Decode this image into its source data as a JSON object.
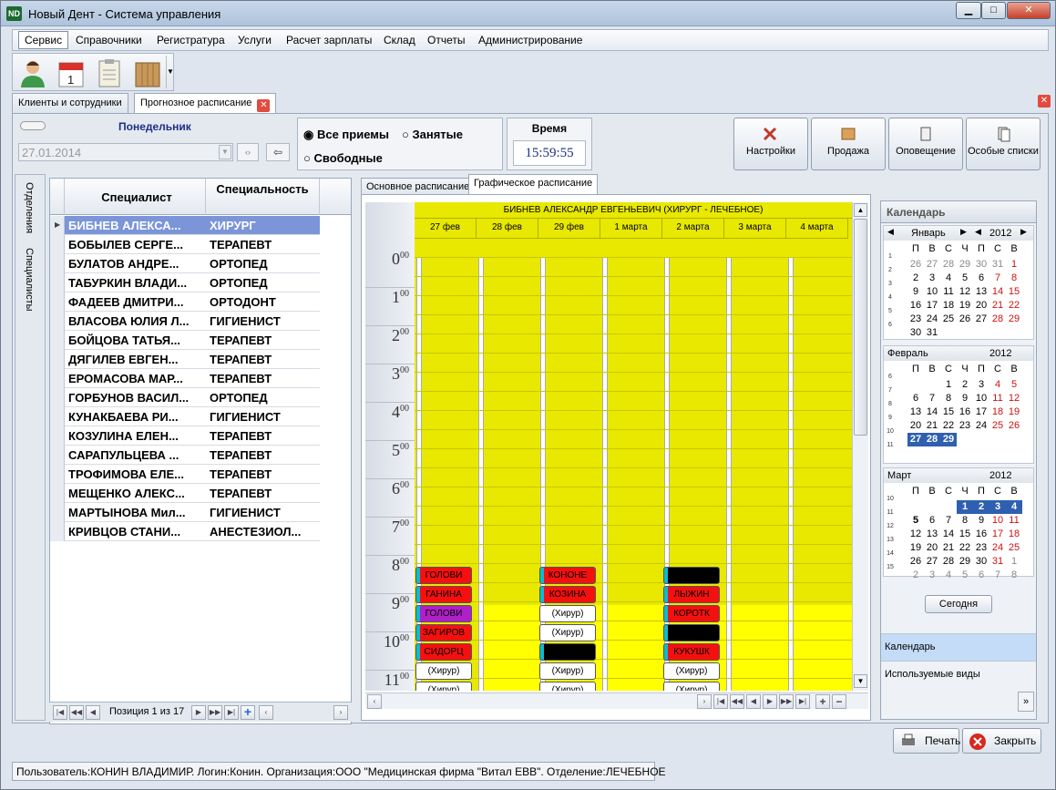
{
  "app": {
    "icon_text": "ND",
    "title": "Новый Дент - Система управления"
  },
  "window_buttons": {
    "min": "▁",
    "max": "□",
    "close": "✕"
  },
  "menu": [
    "Сервис",
    "Справочники",
    "Регистратура",
    "Услуги",
    "Расчет зарплаты",
    "Склад",
    "Отчеты",
    "Администрирование"
  ],
  "doc_tabs": [
    {
      "label": "Клиенты и сотрудники"
    },
    {
      "label": "Прогнозное расписание"
    }
  ],
  "day": {
    "label": "Понедельник",
    "date": "27.01.2014"
  },
  "filters": {
    "all": "Все приемы",
    "busy": "Занятые",
    "free": "Свободные"
  },
  "time": {
    "label": "Время",
    "value": "15:59:55"
  },
  "action_buttons": [
    "Настройки",
    "Продажа",
    "Оповещение",
    "Особые списки"
  ],
  "side_tabs": {
    "departments": "Отделения",
    "specialists": "Специалисты"
  },
  "grid": {
    "col_specialist": "Специалист",
    "col_specialty": "Специальность",
    "rows": [
      {
        "name": "БИБНЕВ АЛЕКСА...",
        "spec": "ХИРУРГ"
      },
      {
        "name": "БОБЫЛЕВ СЕРГЕ...",
        "spec": "ТЕРАПЕВТ"
      },
      {
        "name": "БУЛАТОВ АНДРЕ...",
        "spec": "ОРТОПЕД"
      },
      {
        "name": "ТАБУРКИН ВЛАДИ...",
        "spec": "ОРТОПЕД"
      },
      {
        "name": "ФАДЕЕВ ДМИТРИ...",
        "spec": "ОРТОДОНТ"
      },
      {
        "name": "ВЛАСОВА ЮЛИЯ Л...",
        "spec": "ГИГИЕНИСТ"
      },
      {
        "name": "БОЙЦОВА ТАТЬЯ...",
        "spec": "ТЕРАПЕВТ"
      },
      {
        "name": "ДЯГИЛЕВ ЕВГЕН...",
        "spec": "ТЕРАПЕВТ"
      },
      {
        "name": "ЕРОМАСОВА МАР...",
        "spec": "ТЕРАПЕВТ"
      },
      {
        "name": "ГОРБУНОВ ВАСИЛ...",
        "spec": "ОРТОПЕД"
      },
      {
        "name": "КУНАКБАЕВА РИ...",
        "spec": "ГИГИЕНИСТ"
      },
      {
        "name": "КОЗУЛИНА ЕЛЕН...",
        "spec": "ТЕРАПЕВТ"
      },
      {
        "name": "САРАПУЛЬЦЕВА ...",
        "spec": "ТЕРАПЕВТ"
      },
      {
        "name": "ТРОФИМОВА ЕЛЕ...",
        "spec": "ТЕРАПЕВТ"
      },
      {
        "name": "МЕЩЕНКО АЛЕКС...",
        "spec": "ТЕРАПЕВТ"
      },
      {
        "name": "МАРТЫНОВА Мил...",
        "spec": "ГИГИЕНИСТ"
      },
      {
        "name": "КРИВЦОВ СТАНИ...",
        "spec": "АНЕСТЕЗИОЛ..."
      }
    ],
    "position": "Позиция 1 из 17"
  },
  "sched_tabs": [
    "Основное расписание",
    "Графическое расписание"
  ],
  "schedule": {
    "doctor": "БИБНЕВ АЛЕКСАНДР ЕВГЕНЬЕВИЧ (ХИРУРГ - ЛЕЧЕБНОЕ)",
    "days": [
      "27 фев",
      "28 фев",
      "29 фев",
      "1 марта",
      "2 марта",
      "3 марта",
      "4 марта"
    ],
    "hours": [
      "0",
      "1",
      "2",
      "3",
      "4",
      "5",
      "6",
      "7",
      "8",
      "9",
      "10",
      "11"
    ],
    "hour_sup": "00",
    "appointments": [
      {
        "day": 0,
        "slot": 0,
        "text": "ГОЛОВИ",
        "type": "red"
      },
      {
        "day": 0,
        "slot": 1,
        "text": "ГАНИНА",
        "type": "red"
      },
      {
        "day": 0,
        "slot": 2,
        "text": "ГОЛОВИ",
        "type": "purple"
      },
      {
        "day": 0,
        "slot": 3,
        "text": "ЗАГИРОВ",
        "type": "red"
      },
      {
        "day": 0,
        "slot": 4,
        "text": "СИДОРЦ",
        "type": "red"
      },
      {
        "day": 0,
        "slot": 5,
        "text": "(Хирур)",
        "type": "white"
      },
      {
        "day": 0,
        "slot": 6,
        "text": "(Хирур)",
        "type": "white"
      },
      {
        "day": 2,
        "slot": 0,
        "text": "КОНОНЕ",
        "type": "red"
      },
      {
        "day": 2,
        "slot": 1,
        "text": "КОЗИНА",
        "type": "red"
      },
      {
        "day": 2,
        "slot": 2,
        "text": "(Хирур)",
        "type": "white"
      },
      {
        "day": 2,
        "slot": 3,
        "text": "(Хирур)",
        "type": "white"
      },
      {
        "day": 2,
        "slot": 4,
        "text": "",
        "type": "black"
      },
      {
        "day": 2,
        "slot": 5,
        "text": "(Хирур)",
        "type": "white"
      },
      {
        "day": 2,
        "slot": 6,
        "text": "(Хирур)",
        "type": "white"
      },
      {
        "day": 4,
        "slot": 0,
        "text": "",
        "type": "black"
      },
      {
        "day": 4,
        "slot": 1,
        "text": "ЛЫЖИН",
        "type": "red"
      },
      {
        "day": 4,
        "slot": 2,
        "text": "КОРОТК",
        "type": "red"
      },
      {
        "day": 4,
        "slot": 3,
        "text": "",
        "type": "black"
      },
      {
        "day": 4,
        "slot": 4,
        "text": "КУКУШК",
        "type": "red"
      },
      {
        "day": 4,
        "slot": 5,
        "text": "(Хирур)",
        "type": "white"
      },
      {
        "day": 4,
        "slot": 6,
        "text": "(Хирур)",
        "type": "white"
      }
    ]
  },
  "calendar": {
    "title": "Календарь",
    "jan": {
      "name": "Январь",
      "year": "2012"
    },
    "feb": {
      "name": "Февраль",
      "year": "2012"
    },
    "mar": {
      "name": "Март",
      "year": "2012"
    },
    "dow": [
      "П",
      "В",
      "С",
      "Ч",
      "П",
      "С",
      "В"
    ],
    "today": "Сегодня",
    "nav": [
      "Календарь",
      "Используемые виды"
    ]
  },
  "bottom": {
    "print": "Печать",
    "close": "Закрыть"
  },
  "status": "Пользователь:КОНИН ВЛАДИМИР. Логин:Конин. Организация:ООО \"Медицинская фирма \"Витал ЕВВ\". Отделение:ЛЕЧЕБНОЕ",
  "colors": {
    "schedule_bg": "#e8e800",
    "selection": "#7b95d8",
    "appt_red": "#f51010"
  }
}
